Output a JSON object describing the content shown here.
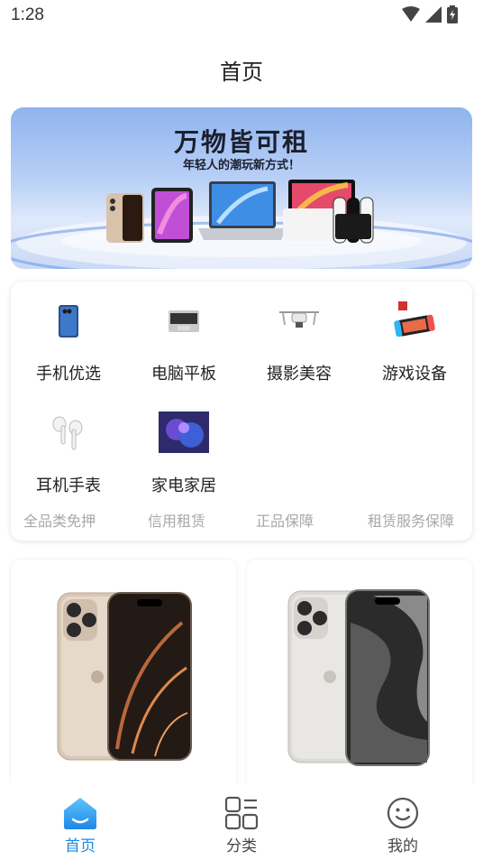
{
  "status": {
    "time": "1:28"
  },
  "header": {
    "title": "首页"
  },
  "banner": {
    "title": "万物皆可租",
    "subtitle": "年轻人的潮玩新方式！"
  },
  "categories": [
    {
      "label": "手机优选",
      "icon": "phone-icon"
    },
    {
      "label": "电脑平板",
      "icon": "laptop-icon"
    },
    {
      "label": "摄影美容",
      "icon": "drone-icon"
    },
    {
      "label": "游戏设备",
      "icon": "game-console-icon"
    },
    {
      "label": "耳机手表",
      "icon": "earbuds-icon"
    },
    {
      "label": "家电家居",
      "icon": "tv-icon"
    }
  ],
  "guarantees": [
    "全品类免押",
    "信用租赁",
    "正品保障",
    "租赁服务保障"
  ],
  "products": [
    {
      "name": "iphone-desert",
      "color": "#c9b6a3"
    },
    {
      "name": "iphone-natural",
      "color": "#d6d3cc"
    }
  ],
  "tabs": [
    {
      "label": "首页",
      "icon": "home-icon",
      "active": true
    },
    {
      "label": "分类",
      "icon": "category-icon",
      "active": false
    },
    {
      "label": "我的",
      "icon": "profile-icon",
      "active": false
    }
  ],
  "colors": {
    "accent": "#1e88e5",
    "muted": "#a8a8a8"
  }
}
